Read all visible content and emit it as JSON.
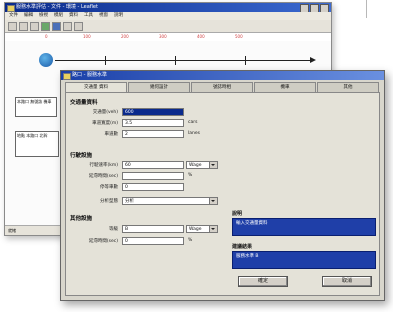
{
  "back_window": {
    "title": "服務水準評估 - 文件 - 環境 - Leaflet",
    "menu": [
      "文件",
      "編輯",
      "檢視",
      "模組",
      "資料",
      "工具",
      "視窗",
      "說明"
    ],
    "ruler": [
      "0",
      "100",
      "200",
      "300",
      "400",
      "500"
    ],
    "node1_text": "本路口 無號誌 機車",
    "node2_text": "地點 本路口 北幹",
    "status": "就緒"
  },
  "dialog": {
    "title": "路口 - 服務水準",
    "tabs": [
      "交通量 資料",
      "幾何設計",
      "號誌時相",
      "機車",
      "其他"
    ],
    "section1": {
      "title": "交通量資料",
      "fields": [
        {
          "label": "交通量(veh)",
          "value": "600",
          "unit": ""
        },
        {
          "label": "車道寬度(m)",
          "value": "3.5",
          "unit": "cars"
        },
        {
          "label": "車道數",
          "value": "2",
          "unit": "lanes"
        }
      ]
    },
    "section2": {
      "title": "行駛設施",
      "fields": [
        {
          "label": "行駛速率(km)",
          "value": "60",
          "unit": "",
          "combo": "Wage"
        },
        {
          "label": "延滯時間(sec)",
          "value": "",
          "unit": "%"
        },
        {
          "label": "停等車數",
          "value": "0",
          "unit": ""
        },
        {
          "label": "分析型態",
          "value": "分析",
          "unit": ""
        }
      ]
    },
    "section3": {
      "title": "其他設施",
      "fields": [
        {
          "label": "等級",
          "value": "B",
          "unit": "",
          "combo": "Wage"
        },
        {
          "label": "延滯時間(sec)",
          "value": "0",
          "unit": "%"
        }
      ]
    },
    "right_label1": "說明",
    "right_info1": "輸入交通量資料",
    "right_label2": "建議結果",
    "right_info2": "服務水準 B",
    "ok_label": "確定",
    "cancel_label": "取消"
  }
}
